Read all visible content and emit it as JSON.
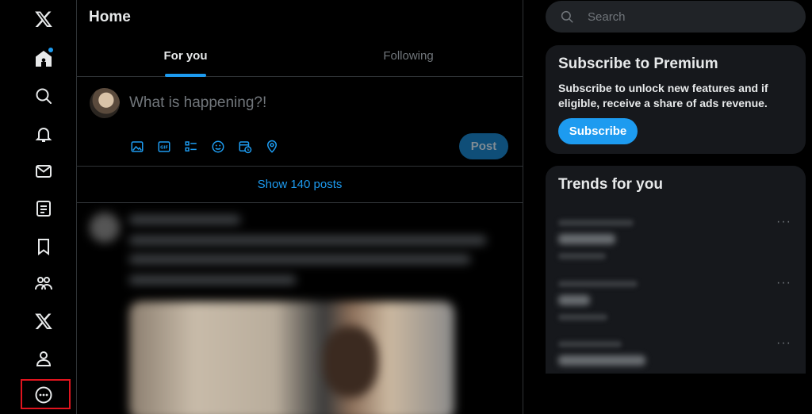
{
  "nav": {
    "items": [
      {
        "name": "x-logo",
        "label": "X"
      },
      {
        "name": "home",
        "label": "Home"
      },
      {
        "name": "explore",
        "label": "Explore"
      },
      {
        "name": "notifications",
        "label": "Notifications"
      },
      {
        "name": "messages",
        "label": "Messages"
      },
      {
        "name": "lists",
        "label": "Lists"
      },
      {
        "name": "bookmarks",
        "label": "Bookmarks"
      },
      {
        "name": "communities",
        "label": "Communities"
      },
      {
        "name": "premium",
        "label": "Premium"
      },
      {
        "name": "profile",
        "label": "Profile"
      },
      {
        "name": "more",
        "label": "More"
      }
    ]
  },
  "main": {
    "title": "Home",
    "tabs": [
      {
        "label": "For you",
        "active": true
      },
      {
        "label": "Following",
        "active": false
      }
    ],
    "composer": {
      "placeholder": "What is happening?!",
      "post_label": "Post",
      "tools": [
        "media-icon",
        "gif-icon",
        "poll-icon",
        "emoji-icon",
        "schedule-icon",
        "location-icon"
      ]
    },
    "show_posts_label": "Show 140 posts"
  },
  "sidebar": {
    "search_placeholder": "Search",
    "premium": {
      "title": "Subscribe to Premium",
      "text": "Subscribe to unlock new features and if eligible, receive a share of ads revenue.",
      "button_label": "Subscribe"
    },
    "trends": {
      "title": "Trends for you",
      "more_label": "···"
    }
  },
  "colors": {
    "accent": "#1d9bf0",
    "background": "#000000",
    "card": "#16181c",
    "border": "#2f3336",
    "muted": "#71767b",
    "highlight": "#e0141e"
  }
}
